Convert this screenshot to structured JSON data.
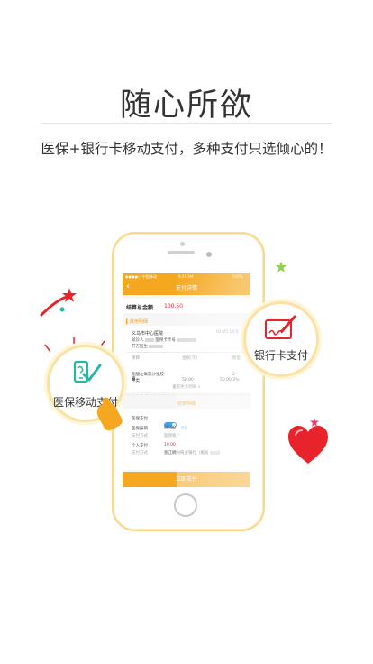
{
  "headline": "随心所欲",
  "tagline": "医保+银行卡移动支付，多种支付只选倾心的！",
  "phone": {
    "status": {
      "carrier": "●●●●○ 中国移动",
      "time": "9:41 AM",
      "battery": "100%"
    },
    "nav": {
      "back": "‹",
      "title": "支付详情"
    },
    "total": {
      "label": "结算总金额",
      "value": "100.50"
    },
    "fee_section": "费用明细",
    "hospital": "义乌市中心医院",
    "visit_date": "01-05 14:0",
    "patient_prefix": "就诊人",
    "card_prefix": "医保卡卡号",
    "doctor_prefix": "开方医生",
    "table_headers": [
      "项目",
      "金额(元)",
      "数量"
    ],
    "items": [
      {
        "name": "盐酸左氧氟沙星胶囊",
        "unit": "甲类",
        "amount": "58.00",
        "qty": "2",
        "ratio": "50.00/2%"
      }
    ],
    "more_link": "查看更多明细 ∨",
    "settle_section": "结算明细",
    "settle_rows": [
      {
        "label": "医保支付",
        "value": "开启",
        "kind": "toggle"
      },
      {
        "label": "医保报销",
        "value": "90.50",
        "kind": "text"
      },
      {
        "label": "支付方式",
        "value": "医保账户",
        "kind": "muted"
      },
      {
        "label": "个人支付",
        "value": "10.00",
        "kind": "red"
      },
      {
        "label": "支付方式",
        "value": "浙江稠州商业银行（尾号",
        "kind": "text"
      }
    ],
    "pay_button": "立即支付"
  },
  "bubbles": {
    "left_label": "医保移动支付",
    "right_label": "银行卡支付"
  },
  "icon_names": [
    "phone-shield-check-icon",
    "pen-signature-card-icon",
    "tap-hand-icon",
    "heart-icon",
    "star-icon"
  ],
  "colors": {
    "accent": "#f5a81f",
    "red": "#e8232b",
    "teal": "#29b6a6",
    "green": "#8fd14f"
  }
}
